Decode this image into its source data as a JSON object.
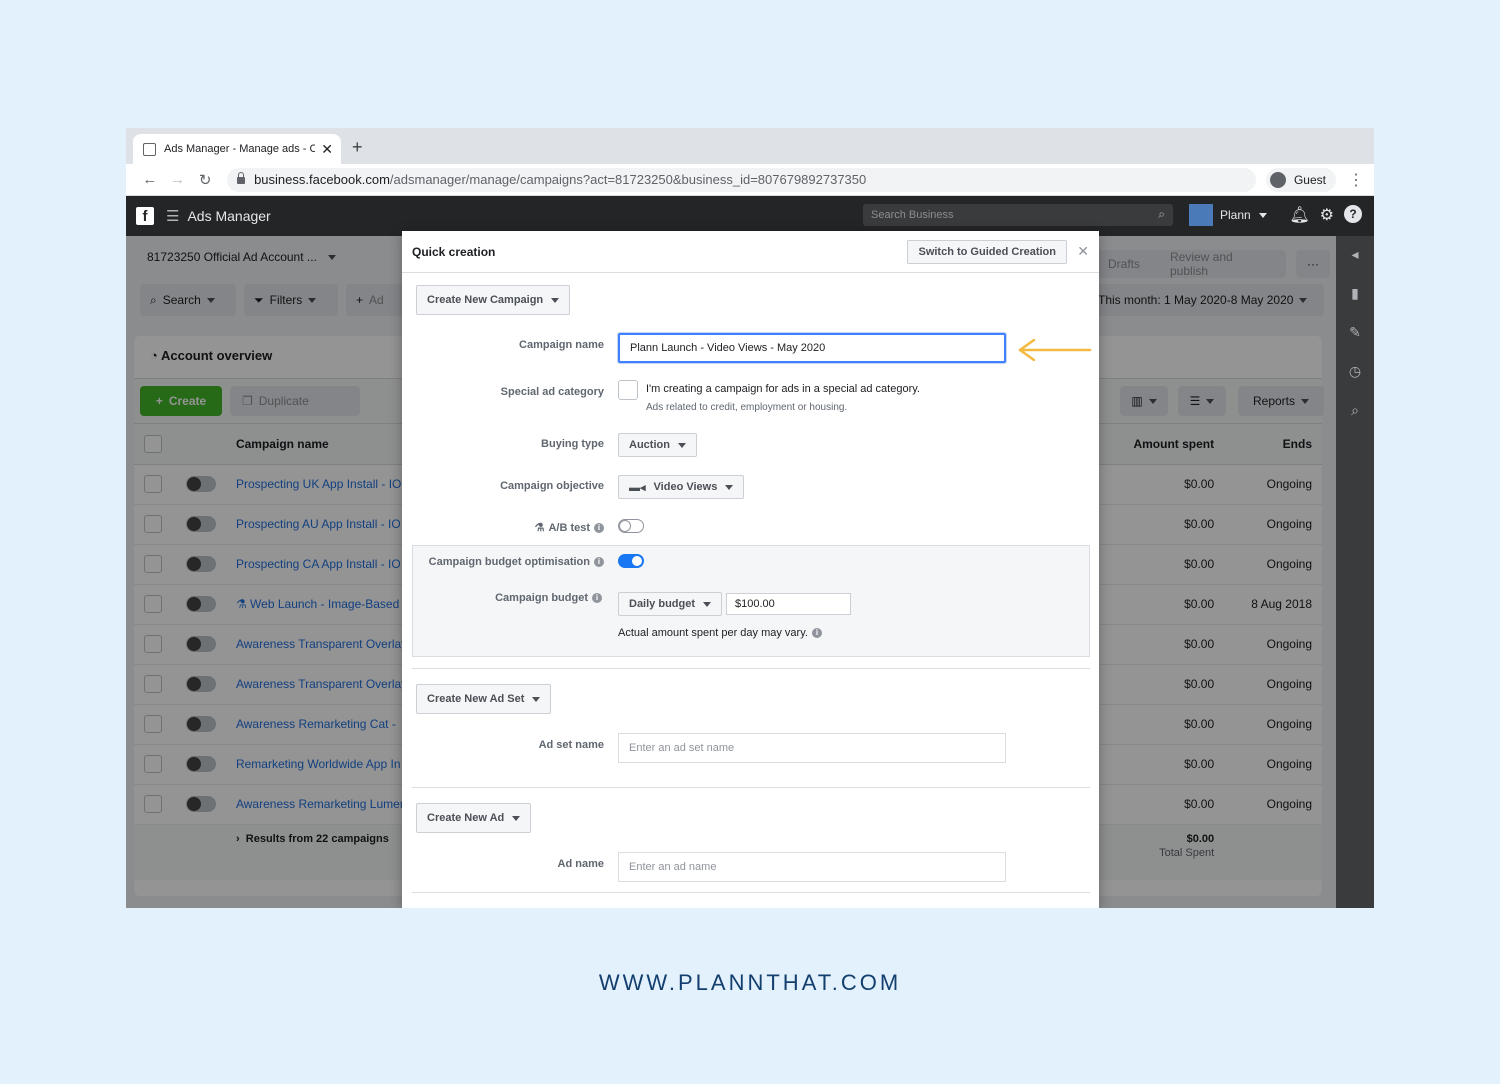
{
  "browser": {
    "tab_title": "Ads Manager - Manage ads - C",
    "url_host": "business.facebook.com",
    "url_path": "/adsmanager/manage/campaigns?act=81723250&business_id=807679892737350",
    "guest_label": "Guest"
  },
  "fbbar": {
    "app_title": "Ads Manager",
    "search_placeholder": "Search Business",
    "account_name": "Plann"
  },
  "toolbar": {
    "account_selector": "81723250 Official Ad Account ...",
    "search_label": "Search",
    "filters_label": "Filters",
    "add_label": "Ad",
    "drafts_label": "Drafts",
    "review_publish_label": "Review and publish",
    "date_range": "This month: 1 May 2020-8 May 2020"
  },
  "overview": {
    "title": "Account overview",
    "create_label": "Create",
    "duplicate_label": "Duplicate",
    "reports_label": "Reports"
  },
  "table": {
    "columns": {
      "campaign_name": "Campaign name",
      "amount_spent": "Amount spent",
      "ends": "Ends"
    },
    "rows": [
      {
        "name": "Prospecting UK App Install - IO",
        "amount": "$0.00",
        "ends": "Ongoing"
      },
      {
        "name": "Prospecting AU App Install - IO",
        "amount": "$0.00",
        "ends": "Ongoing"
      },
      {
        "name": "Prospecting CA App Install - IO",
        "amount": "$0.00",
        "ends": "Ongoing"
      },
      {
        "name": "⚗ Web Launch - Image-Based",
        "amount": "$0.00",
        "ends": "8 Aug 2018"
      },
      {
        "name": "Awareness Transparent Overlay",
        "amount": "$0.00",
        "ends": "Ongoing"
      },
      {
        "name": "Awareness Transparent Overlay",
        "amount": "$0.00",
        "ends": "Ongoing"
      },
      {
        "name": "Awareness Remarketing Cat -",
        "amount": "$0.00",
        "ends": "Ongoing"
      },
      {
        "name": "Remarketing Worldwide App In",
        "amount": "$0.00",
        "ends": "Ongoing"
      },
      {
        "name": "Awareness Remarketing Lumen",
        "amount": "$0.00",
        "ends": "Ongoing"
      }
    ],
    "footer": {
      "results": "Results from 22 campaigns",
      "total": "$0.00",
      "total_label": "Total Spent"
    }
  },
  "modal": {
    "title": "Quick creation",
    "guided_button": "Switch to Guided Creation",
    "campaign_dropdown": "Create New Campaign",
    "campaign_name_label": "Campaign name",
    "campaign_name_value": "Plann Launch - Video Views - May 2020",
    "special_ad_label": "Special ad category",
    "special_ad_text": "I'm creating a campaign for ads in a special ad category.",
    "special_ad_sub": "Ads related to credit, employment or housing.",
    "buying_type_label": "Buying type",
    "buying_type_value": "Auction",
    "objective_label": "Campaign objective",
    "objective_value": "Video Views",
    "ab_test_label": "A/B test",
    "cbo_label": "Campaign budget optimisation",
    "budget_label": "Campaign budget",
    "budget_type": "Daily budget",
    "budget_value": "$100.00",
    "budget_note": "Actual amount spent per day may vary.",
    "adset_dropdown": "Create New Ad Set",
    "adset_name_label": "Ad set name",
    "adset_placeholder": "Enter an ad set name",
    "ad_dropdown": "Create New Ad",
    "ad_name_label": "Ad name",
    "ad_placeholder": "Enter an ad name"
  },
  "footer_text": "WWW.PLANNTHAT.COM",
  "colors": {
    "highlight_arrow": "#f5b942",
    "create_green": "#42b72a",
    "link_blue": "#216fdb",
    "toggle_on": "#1877f2"
  }
}
